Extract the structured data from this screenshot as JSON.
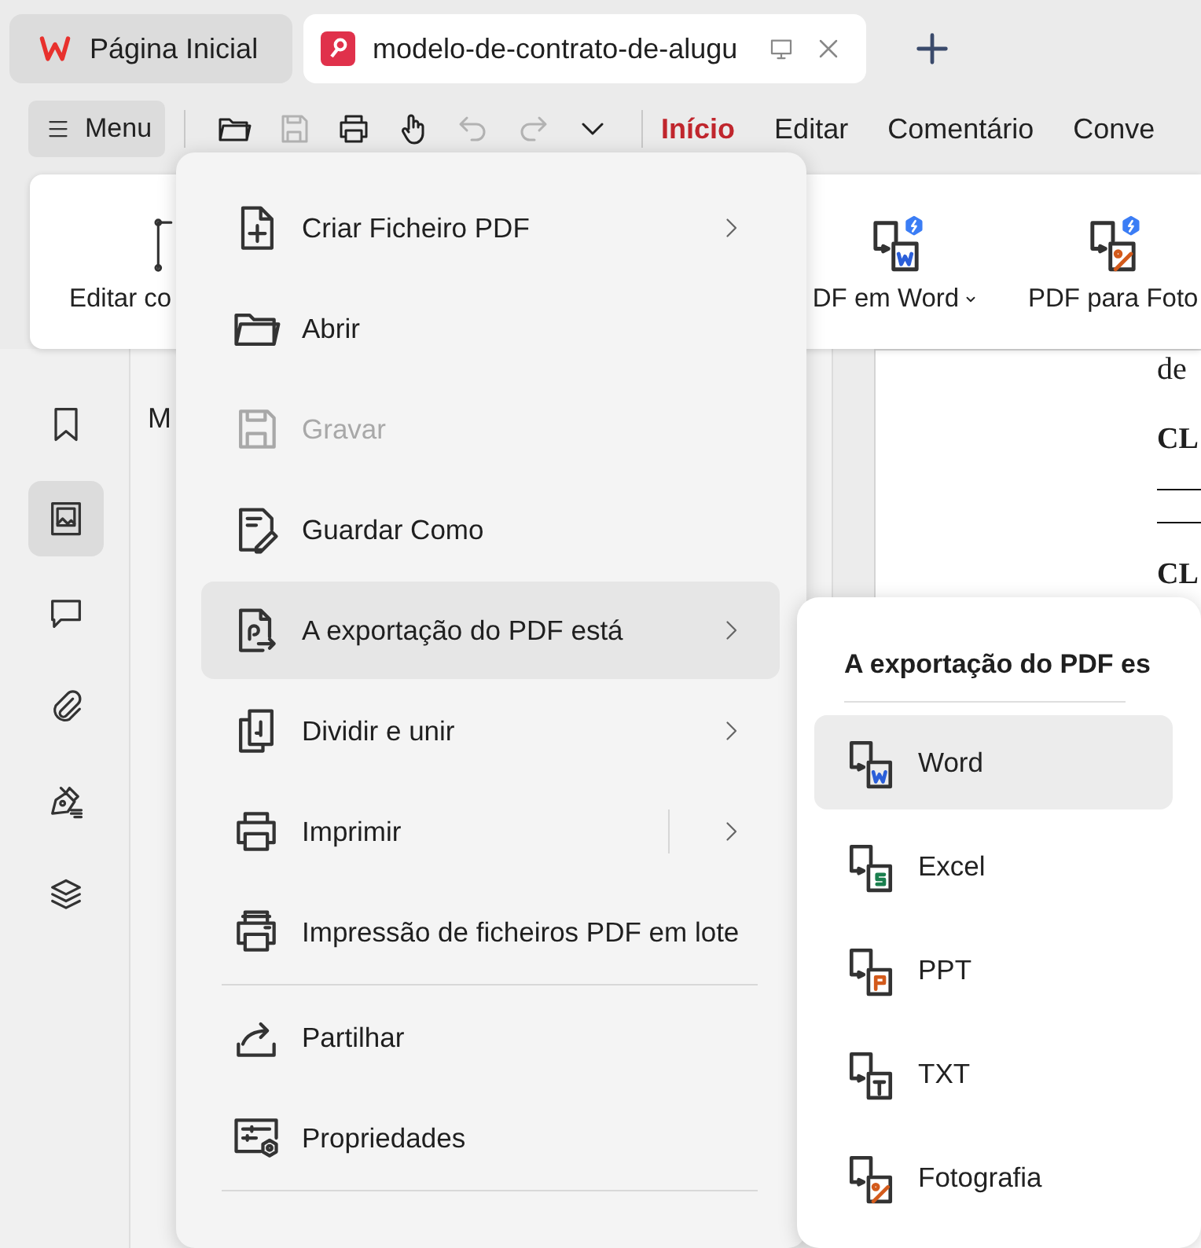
{
  "tabs": [
    {
      "kind": "home",
      "label": "Página Inicial",
      "selected": false
    },
    {
      "kind": "document",
      "label": "modelo-de-contrato-de-alugu",
      "selected": true
    }
  ],
  "menu_button": {
    "label": "Menu"
  },
  "quick_actions": [
    {
      "kind": "open",
      "disabled": false
    },
    {
      "kind": "save",
      "disabled": true
    },
    {
      "kind": "print",
      "disabled": false
    },
    {
      "kind": "hand",
      "disabled": false
    },
    {
      "kind": "undo",
      "disabled": true
    },
    {
      "kind": "redo",
      "disabled": true
    },
    {
      "kind": "more",
      "disabled": false
    }
  ],
  "ribbon_tabs": [
    {
      "label": "Início",
      "selected": true
    },
    {
      "label": "Editar",
      "selected": false
    },
    {
      "label": "Comentário",
      "selected": false
    },
    {
      "label": "Conve",
      "selected": false
    }
  ],
  "ribbon": {
    "buttons": [
      {
        "kind": "edit",
        "label": "Editar co",
        "dropdown": false
      },
      {
        "kind": "word",
        "label": "DF em Word",
        "dropdown": true
      },
      {
        "kind": "photo",
        "label": "PDF para Foto",
        "dropdown": false
      }
    ]
  },
  "sidebar": {
    "items": [
      {
        "kind": "bookmark",
        "selected": false
      },
      {
        "kind": "thumbnail",
        "selected": true
      },
      {
        "kind": "comment",
        "selected": false
      },
      {
        "kind": "attachment",
        "selected": false
      },
      {
        "kind": "signature",
        "selected": false
      },
      {
        "kind": "layers",
        "selected": false
      }
    ]
  },
  "panel": {
    "title": "M"
  },
  "document": {
    "lines": [
      {
        "kind": "text",
        "text": "de"
      },
      {
        "kind": "heading",
        "text": "CL"
      },
      {
        "kind": "rule"
      },
      {
        "kind": "rule"
      },
      {
        "kind": "heading",
        "text": "CL"
      }
    ]
  },
  "file_menu": {
    "items": [
      {
        "kind": "create",
        "label": "Criar Ficheiro PDF",
        "disabled": false,
        "selected": false,
        "submenu": true,
        "split": false
      },
      {
        "kind": "open",
        "label": "Abrir",
        "disabled": false,
        "selected": false,
        "submenu": false,
        "split": false
      },
      {
        "kind": "save",
        "label": "Gravar",
        "disabled": true,
        "selected": false,
        "submenu": false,
        "split": false
      },
      {
        "kind": "save-as",
        "label": "Guardar Como",
        "disabled": false,
        "selected": false,
        "submenu": false,
        "split": false
      },
      {
        "kind": "export",
        "label": "A exportação do PDF está",
        "disabled": false,
        "selected": true,
        "submenu": true,
        "split": false
      },
      {
        "kind": "split",
        "label": "Dividir e unir",
        "disabled": false,
        "selected": false,
        "submenu": true,
        "split": false
      },
      {
        "kind": "print",
        "label": "Imprimir",
        "disabled": false,
        "selected": false,
        "submenu": true,
        "split": true
      },
      {
        "kind": "batch-print",
        "label": "Impressão de ficheiros PDF em lote",
        "disabled": false,
        "selected": false,
        "submenu": false,
        "split": false
      },
      {
        "kind": "divider"
      },
      {
        "kind": "share",
        "label": "Partilhar",
        "disabled": false,
        "selected": false,
        "submenu": false,
        "split": false
      },
      {
        "kind": "properties",
        "label": "Propriedades",
        "disabled": false,
        "selected": false,
        "submenu": false,
        "split": false
      },
      {
        "kind": "divider"
      }
    ]
  },
  "export_menu": {
    "title": "A exportação do PDF es",
    "items": [
      {
        "kind": "word",
        "label": "Word",
        "selected": true
      },
      {
        "kind": "excel",
        "label": "Excel",
        "selected": false
      },
      {
        "kind": "ppt",
        "label": "PPT",
        "selected": false
      },
      {
        "kind": "txt",
        "label": "TXT",
        "selected": false
      },
      {
        "kind": "photo",
        "label": "Fotografia",
        "selected": false
      }
    ]
  }
}
